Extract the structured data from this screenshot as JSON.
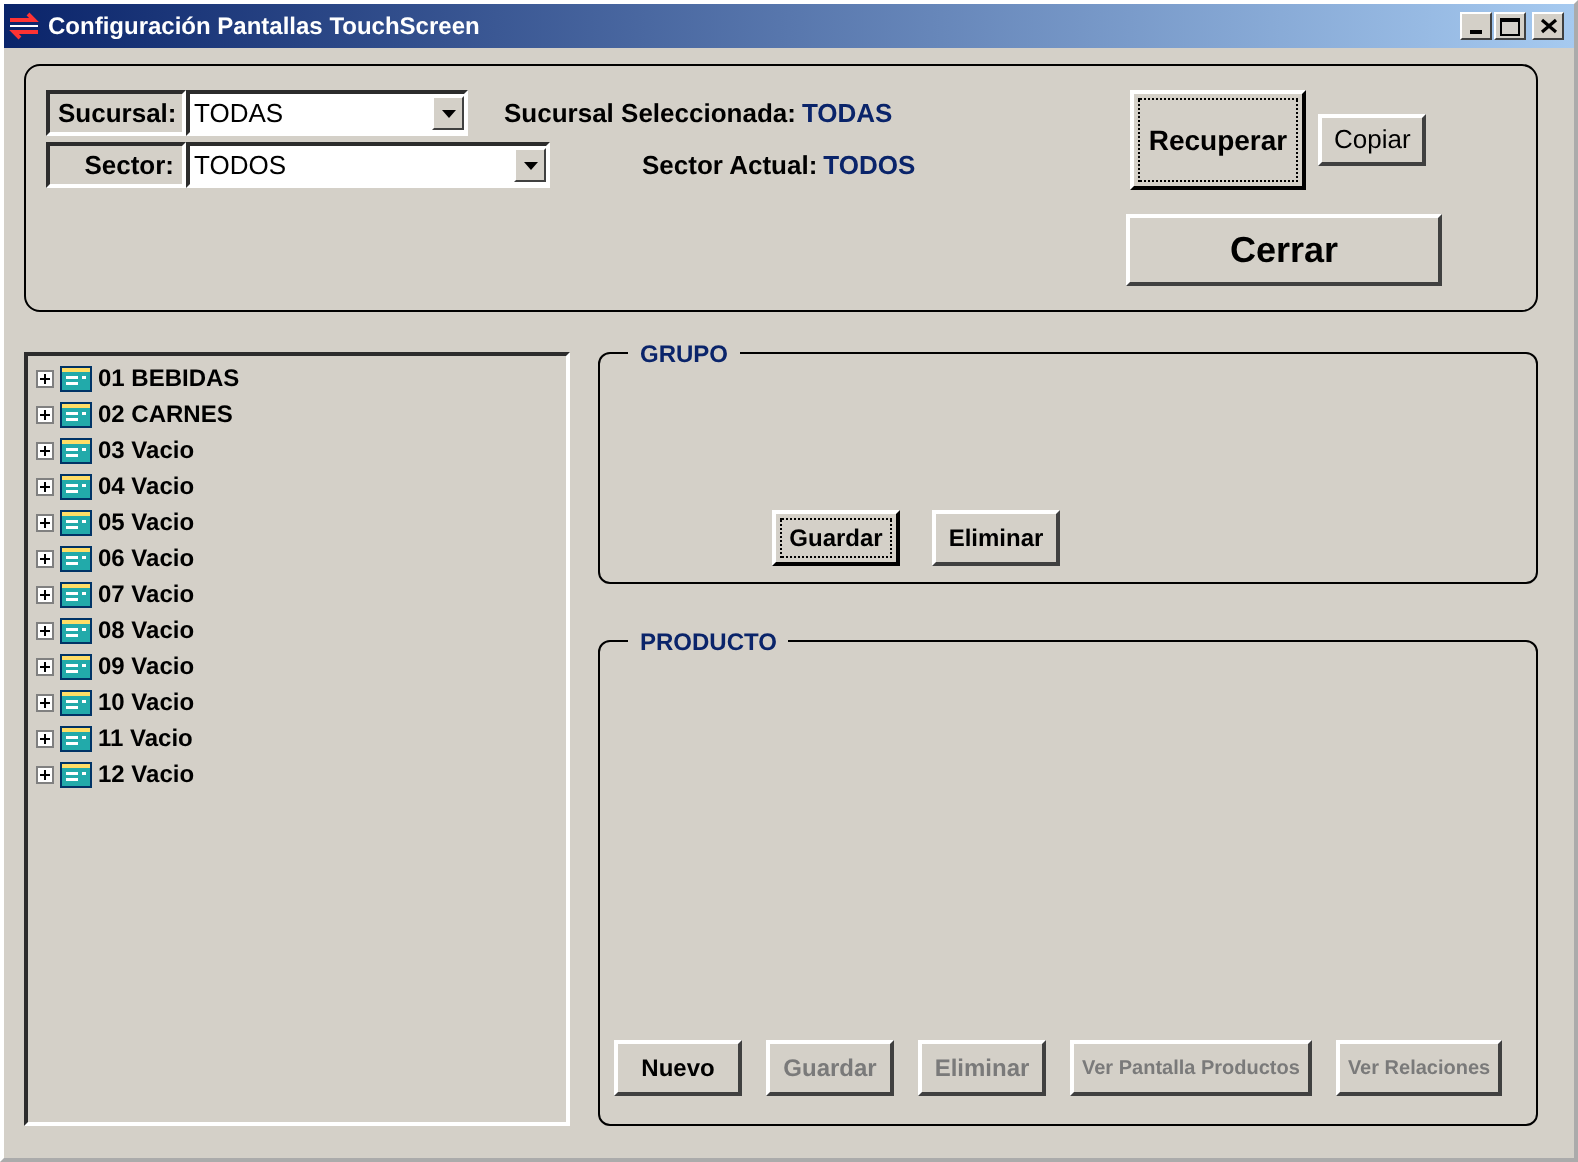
{
  "window": {
    "title": "Configuración Pantallas TouchScreen"
  },
  "filters": [
    {
      "label": "Sucursal:",
      "value": "TODAS",
      "selected_label": "Sucursal Seleccionada:",
      "selected_value": "TODAS"
    },
    {
      "label": "Sector:",
      "value": "TODOS",
      "selected_label": "Sector Actual:",
      "selected_value": "TODOS"
    }
  ],
  "top_buttons": [
    {
      "label": "Recuperar",
      "focused": true
    },
    {
      "label": "Copiar",
      "focused": false
    },
    {
      "label": "Cerrar",
      "focused": false
    }
  ],
  "tree": [
    {
      "label": "01 BEBIDAS",
      "expanded": false
    },
    {
      "label": "02 CARNES",
      "expanded": false
    },
    {
      "label": "03 Vacio",
      "expanded": false
    },
    {
      "label": "04 Vacio",
      "expanded": false
    },
    {
      "label": "05 Vacio",
      "expanded": false
    },
    {
      "label": "06 Vacio",
      "expanded": false
    },
    {
      "label": "07 Vacio",
      "expanded": false
    },
    {
      "label": "08 Vacio",
      "expanded": false
    },
    {
      "label": "09 Vacio",
      "expanded": false
    },
    {
      "label": "10 Vacio",
      "expanded": false
    },
    {
      "label": "11 Vacio",
      "expanded": false
    },
    {
      "label": "12 Vacio",
      "expanded": false
    }
  ],
  "grupo": {
    "title": "GRUPO",
    "buttons": [
      {
        "label": "Guardar",
        "disabled": false,
        "focused": true
      },
      {
        "label": "Eliminar",
        "disabled": false,
        "focused": false
      }
    ]
  },
  "producto": {
    "title": "PRODUCTO",
    "buttons": [
      {
        "label": "Nuevo",
        "disabled": false,
        "focused": false
      },
      {
        "label": "Guardar",
        "disabled": true,
        "focused": false
      },
      {
        "label": "Eliminar",
        "disabled": true,
        "focused": false
      },
      {
        "label": "Ver Pantalla Productos",
        "disabled": true,
        "focused": false
      },
      {
        "label": "Ver Relaciones",
        "disabled": true,
        "focused": false
      }
    ]
  }
}
